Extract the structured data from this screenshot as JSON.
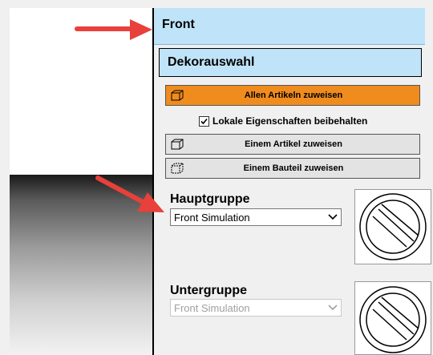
{
  "panel": {
    "title": "Front",
    "section_title": "Dekorauswahl"
  },
  "buttons": {
    "assign_all": "Allen Artikeln zuweisen",
    "assign_article": "Einem Artikel zuweisen",
    "assign_part": "Einem Bauteil zuweisen"
  },
  "checkbox": {
    "label": "Lokale Eigenschaften beibehalten",
    "checked": true
  },
  "hauptgruppe": {
    "label": "Hauptgruppe",
    "value": "Front Simulation"
  },
  "untergruppe": {
    "label": "Untergruppe",
    "value": "Front Simulation"
  },
  "colors": {
    "header_bg": "#bfe3f8",
    "orange_button": "#f08c1e",
    "annotation_arrow": "#e8403a"
  },
  "icons": [
    "cube-icon",
    "checkmark-icon",
    "chevron-down-icon",
    "no-image-icon",
    "arrow-icon"
  ]
}
